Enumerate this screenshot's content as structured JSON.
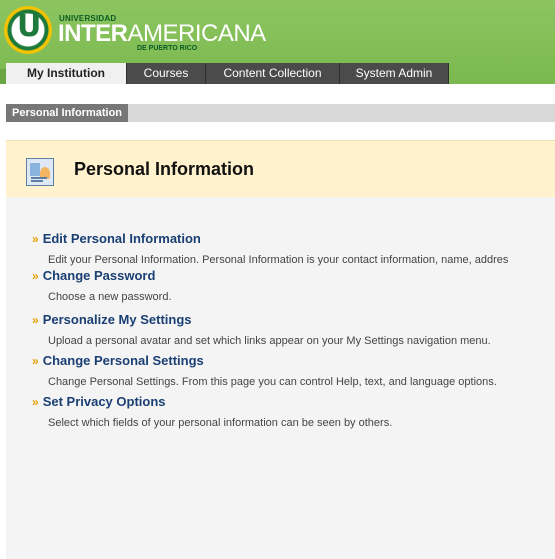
{
  "logo": {
    "small": "UNIVERSIDAD",
    "main_bold": "INTER",
    "main_rest": "AMERICANA",
    "sub": "DE PUERTO RICO",
    "icon": "uipr-seal-icon"
  },
  "tabs": [
    {
      "label": "My Institution",
      "active": true
    },
    {
      "label": "Courses",
      "active": false
    },
    {
      "label": "Content Collection",
      "active": false
    },
    {
      "label": "System Admin",
      "active": false
    }
  ],
  "breadcrumb": "Personal Information",
  "page": {
    "title": "Personal Information",
    "icon": "personal-info-card-icon"
  },
  "items": [
    {
      "label": "Edit Personal Information",
      "desc": "Edit your Personal Information. Personal Information is your contact information, name, addres"
    },
    {
      "label": "Change Password",
      "desc": "Choose a new password."
    },
    {
      "label": "Personalize My Settings",
      "desc": "Upload a personal avatar and set which links appear on your My Settings navigation menu."
    },
    {
      "label": "Change Personal Settings",
      "desc": "Change Personal Settings. From this page you can control Help, text, and language options."
    },
    {
      "label": "Set Privacy Options",
      "desc": "Select which fields of your personal information can be seen by others."
    }
  ],
  "colors": {
    "header_green": "#7bb84f",
    "tab_dark": "#4b4b4b",
    "link_blue": "#1a3f73",
    "chevron_orange": "#e8a000",
    "title_bar": "#fff2cc"
  }
}
